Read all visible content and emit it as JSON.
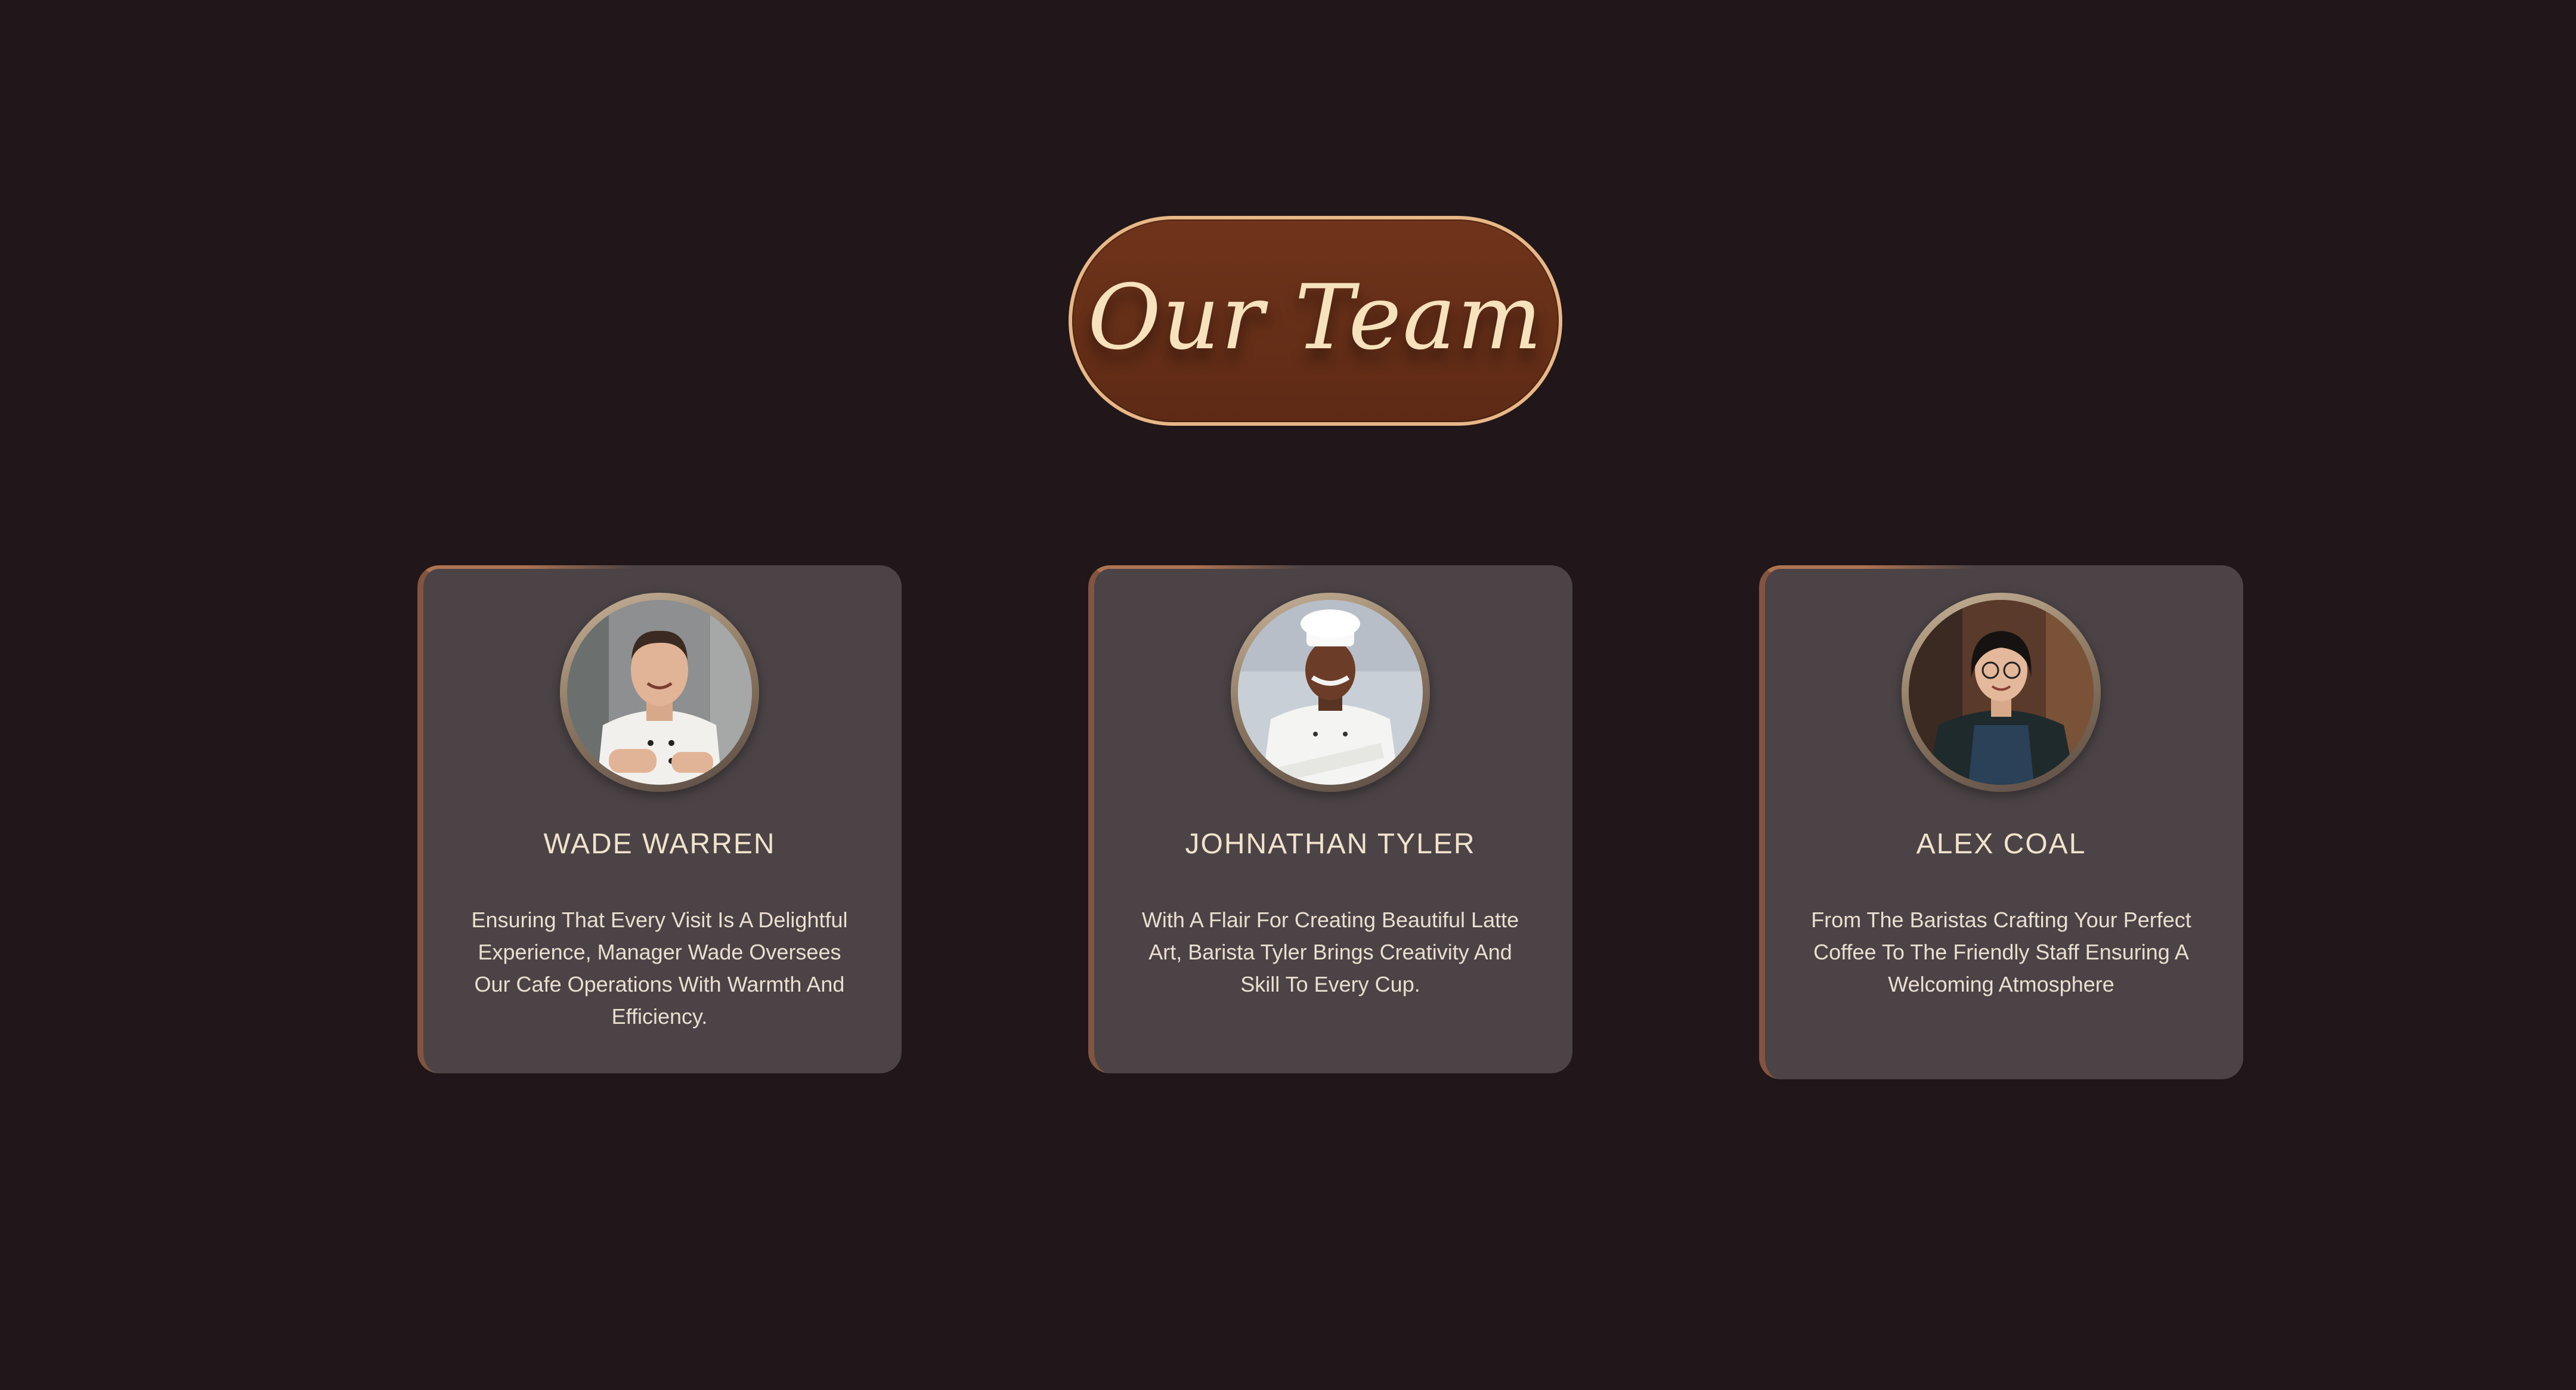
{
  "header": {
    "title": "Our Team"
  },
  "team": [
    {
      "name": "WADE WARREN",
      "description": "Ensuring That Every Visit Is A Delightful Experience, Manager Wade Oversees Our Cafe Operations With Warmth And Efficiency.",
      "photo": "chef-photo-wade"
    },
    {
      "name": "JOHNATHAN TYLER",
      "description": "With A Flair For Creating Beautiful Latte Art, Barista Tyler Brings Creativity And Skill To Every Cup.",
      "photo": "chef-photo-johnathan"
    },
    {
      "name": "ALEX COAL",
      "description": "From The Baristas Crafting Your Perfect Coffee To The Friendly Staff Ensuring A Welcoming Atmosphere",
      "photo": "barista-photo-alex"
    }
  ],
  "colors": {
    "background": "#211619",
    "card": "#4b4346",
    "pill_fill": "#6f341b",
    "pill_border": "#e7b787",
    "title_text": "#f6e2bd",
    "name_text": "#f1e3cc"
  }
}
